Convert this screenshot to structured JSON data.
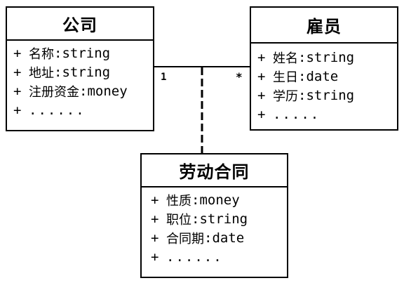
{
  "diagram": {
    "classes": {
      "company": {
        "name": "公司",
        "attributes": [
          {
            "visibility": "+",
            "name": "名称",
            "separator": ":",
            "type": "string"
          },
          {
            "visibility": "+",
            "name": "地址",
            "separator": ":",
            "type": "string"
          },
          {
            "visibility": "+",
            "name": "注册资金",
            "separator": ":",
            "type": "money"
          },
          {
            "visibility": "+",
            "ellipsis": "......"
          }
        ]
      },
      "employee": {
        "name": "雇员",
        "attributes": [
          {
            "visibility": "+",
            "name": "姓名",
            "separator": ":",
            "type": "string"
          },
          {
            "visibility": "+",
            "name": "生日",
            "separator": ":",
            "type": "date"
          },
          {
            "visibility": "+",
            "name": "学历",
            "separator": ":",
            "type": "string"
          },
          {
            "visibility": "+",
            "ellipsis": "....."
          }
        ]
      },
      "contract": {
        "name": "劳动合同",
        "attributes": [
          {
            "visibility": "+",
            "name": "性质",
            "separator": ":",
            "type": "money"
          },
          {
            "visibility": "+",
            "name": "职位",
            "separator": ":",
            "type": "string"
          },
          {
            "visibility": "+",
            "name": "合同期",
            "separator": ":",
            "type": "date"
          },
          {
            "visibility": "+",
            "ellipsis": "......"
          }
        ]
      }
    },
    "association": {
      "company_multiplicity": "1",
      "employee_multiplicity": "*"
    },
    "colors": {
      "line": "#000000",
      "background": "#ffffff"
    }
  }
}
